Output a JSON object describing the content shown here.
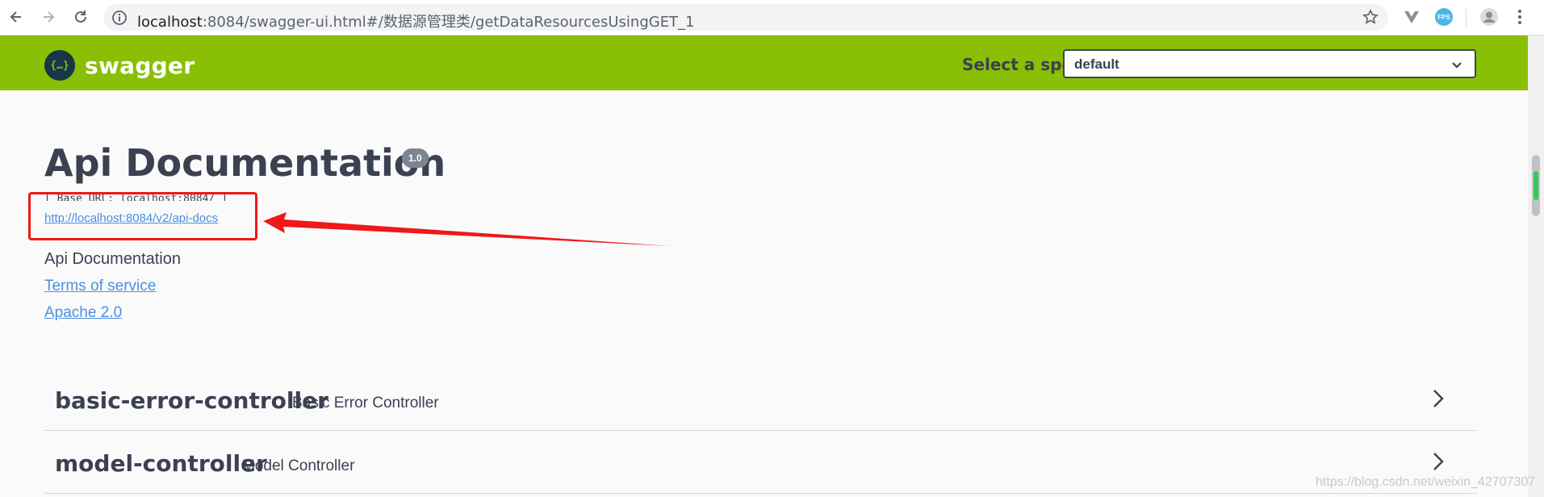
{
  "browser": {
    "url_host": "localhost",
    "url_rest": ":8084/swagger-ui.html#/数据源管理类/getDataResourcesUsingGET_1",
    "ext_label": "FPS"
  },
  "topbar": {
    "logo_symbol": "{…}",
    "logo_text": "swagger",
    "spec_label": "Select a spec",
    "spec_value": "default"
  },
  "info": {
    "title": "Api Documentation",
    "version": "1.0",
    "base_url": "[ Base URL: localhost:8084/ ]",
    "api_docs_url": "http://localhost:8084/v2/api-docs",
    "description": "Api Documentation",
    "terms": "Terms of service",
    "license": "Apache 2.0"
  },
  "tags": [
    {
      "name": "basic-error-controller",
      "description": "Basic Error Controller"
    },
    {
      "name": "model-controller",
      "description": "Model Controller"
    }
  ],
  "watermark": "https://blog.csdn.net/weixin_42707307",
  "colors": {
    "topbar": "#89bf04",
    "annotation": "#f01818",
    "link": "#4990e2"
  }
}
